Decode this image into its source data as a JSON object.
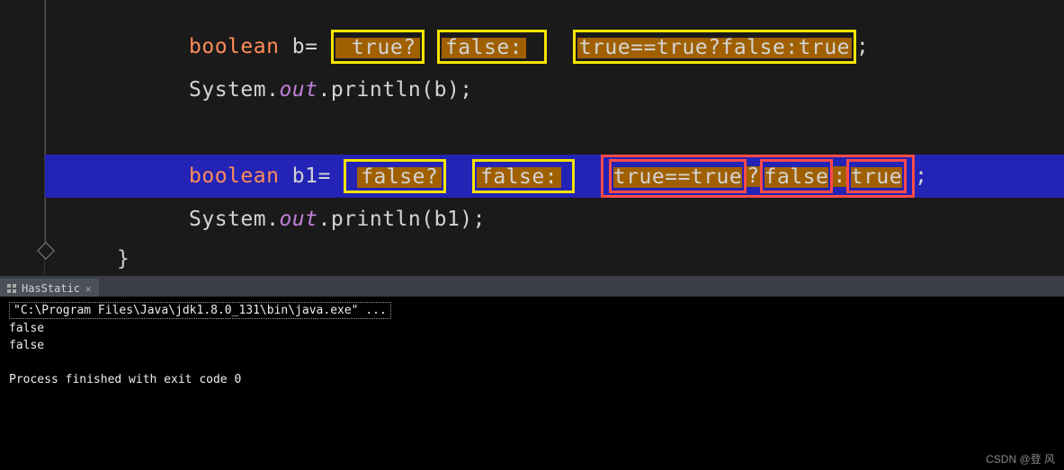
{
  "editor": {
    "line1": {
      "prefix_kw": "boolean",
      "prefix_var": " b= ",
      "box1": "true?",
      "gap1": " ",
      "box2": "false:",
      "gap2": "  ",
      "box3": "true==true?false:true",
      "suffix": ";"
    },
    "line2": {
      "pre": "System.",
      "out": "out",
      "mid": ".println(b);"
    },
    "line3": {
      "prefix_kw": "boolean",
      "prefix_var": " b1= ",
      "box1": "false?",
      "gap1": "  ",
      "box2": "false:",
      "gap2": "  ",
      "outer": {
        "a": "true==true",
        "q": "?",
        "b": "false",
        "c": ":",
        "d": "true"
      },
      "suffix": ";"
    },
    "line4": {
      "pre": "System.",
      "out": "out",
      "mid": ".println(b1);"
    },
    "brace": "}"
  },
  "console": {
    "tab": "HasStatic",
    "cmd": "\"C:\\Program Files\\Java\\jdk1.8.0_131\\bin\\java.exe\" ...",
    "out1": "false",
    "out2": "false",
    "exit": "Process finished with exit code 0"
  },
  "watermark": "CSDN @登 风"
}
